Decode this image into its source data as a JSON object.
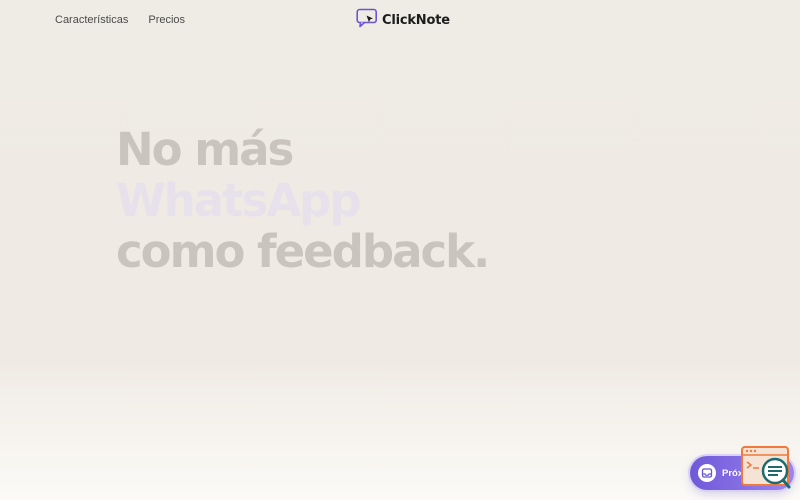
{
  "nav": {
    "links": [
      "Características",
      "Precios"
    ]
  },
  "brand": {
    "name": "ClickNote",
    "logo_icon": "chat-cursor-icon"
  },
  "hero": {
    "line1": "No más",
    "line2": "WhatsApp",
    "line3": "como feedback",
    "dot": "."
  },
  "badge": {
    "label": "Próximam",
    "icon": "inbox-icon"
  },
  "fab": {
    "icon": "search-feedback-icon"
  },
  "colors": {
    "accent": "#7059d8",
    "hero_text": "#c9c4bd",
    "hero_highlight": "#e7e1ec",
    "fab_orange": "#f07a3c",
    "fab_teal": "#1d6a70"
  }
}
